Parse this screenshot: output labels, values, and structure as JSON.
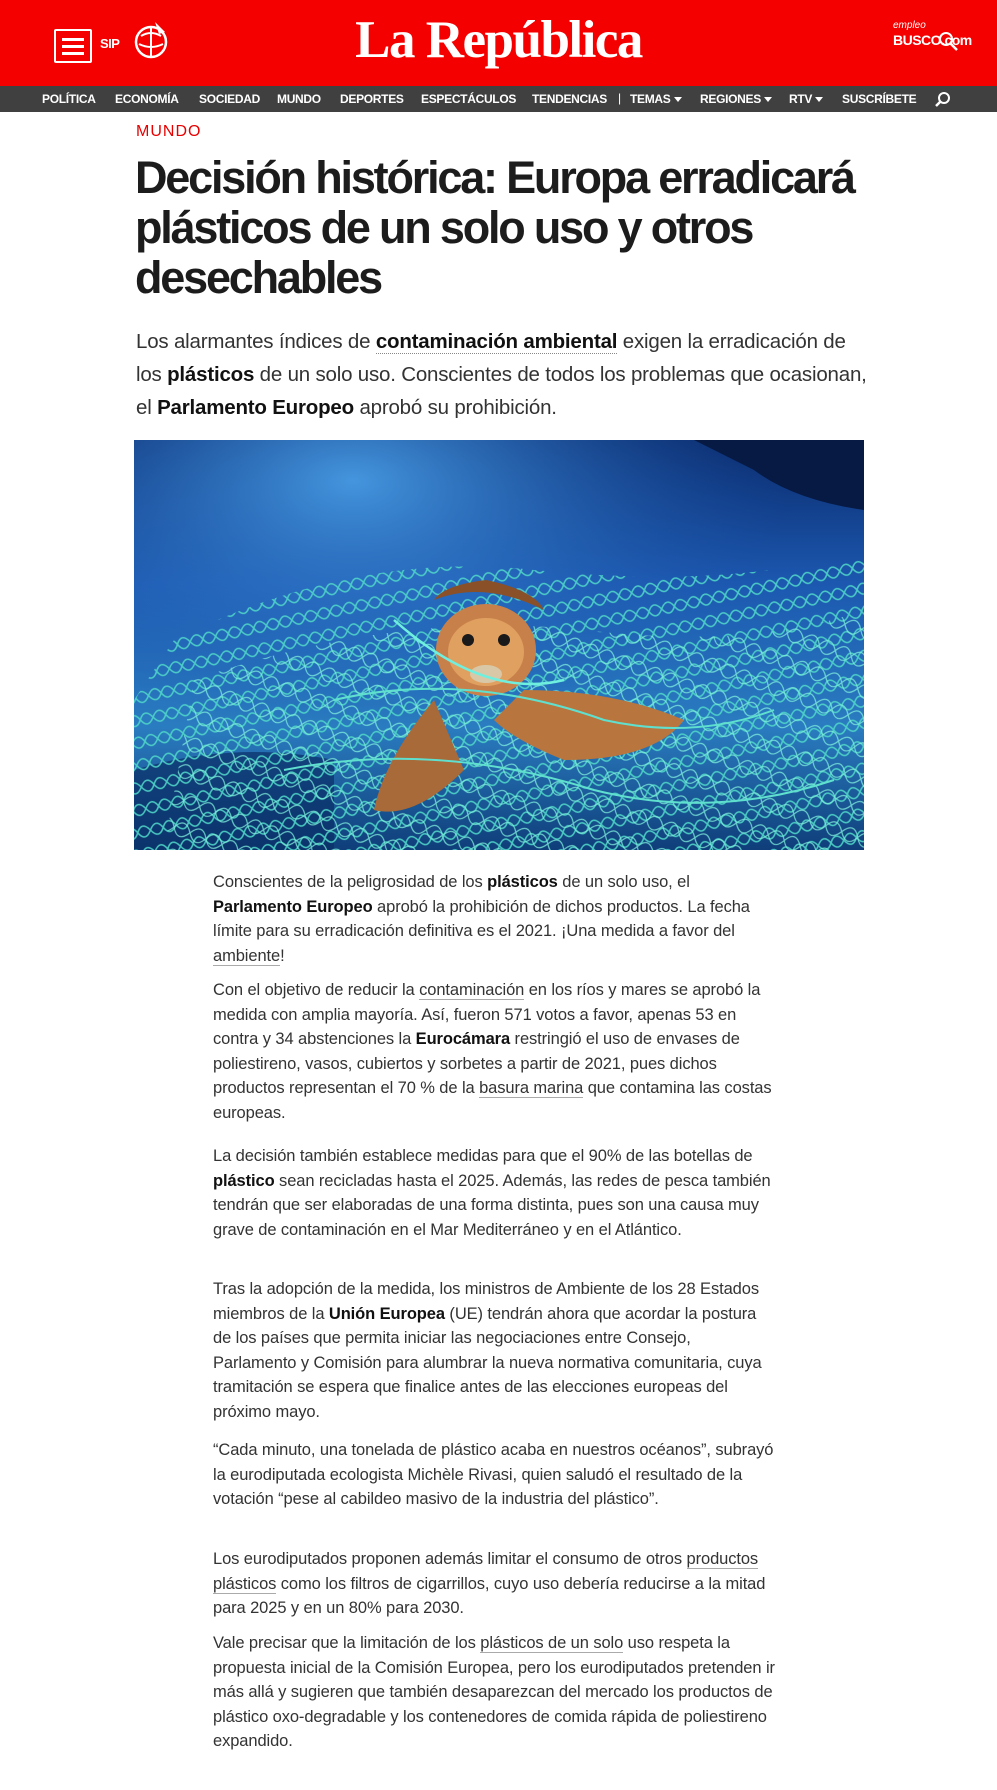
{
  "header": {
    "sip": "SIP",
    "brand": "La República",
    "empleo_small": "empleo",
    "empleo_big": "BUSCO.com",
    "colors": {
      "brand_red": "#f40000",
      "nav_bg": "#404040",
      "section_red": "#e60000"
    }
  },
  "nav": {
    "items": [
      "POLÍTICA",
      "ECONOMÍA",
      "SOCIEDAD",
      "MUNDO",
      "DEPORTES",
      "ESPECTÁCULOS",
      "TENDENCIAS"
    ],
    "separator": "|",
    "dropdowns": [
      "TEMAS",
      "REGIONES",
      "RTV"
    ],
    "subscribe": "SUSCRÍBETE"
  },
  "article": {
    "section": "MUNDO",
    "headline": "Decisión histórica: Europa erradicará plásticos de un solo uso y otros desechables",
    "lead": {
      "t1": "Los alarmantes índices de ",
      "b1": "contaminación ambiental",
      "t2": " exigen la erradicación de los ",
      "b2": "plásticos",
      "t3": " de un solo uso. Conscientes de todos los problemas que ocasionan, el ",
      "b3": "Parlamento Europeo",
      "t4": " aprobó su prohibición."
    },
    "p1": {
      "t1": "Conscientes de la peligrosidad de los ",
      "b1": "plásticos",
      "t2": " de un solo uso, el ",
      "b2": "Parlamento Europeo",
      "t3": " aprobó la prohibición de dichos productos. La fecha límite para su erradicación definitiva es el 2021. ¡Una medida a favor del ",
      "l1": "ambiente",
      "t4": "!"
    },
    "p2": {
      "t1": "Con el objetivo de reducir la ",
      "l1": "contaminación",
      "t2": " en los ríos y mares se aprobó la medida con amplia mayoría. Así, fueron 571 votos a favor, apenas 53 en contra y 34 abstenciones la ",
      "b1": "Eurocámara",
      "t3": " restringió el uso de envases de poliestireno, vasos, cubiertos y sorbetes a partir de 2021, pues dichos productos representan el  70 % de la ",
      "l2": "basura marina",
      "t4": " que contamina las costas europeas."
    },
    "p3": {
      "t1": "La decisión también establece medidas para que el 90% de las botellas de ",
      "b1": "plástico",
      "t2": " sean recicladas hasta el 2025. Además, las redes de pesca también tendrán que ser elaboradas de una forma distinta, pues son una causa muy grave de contaminación en el Mar Mediterráneo y en el Atlántico."
    },
    "p4": {
      "t1": "Tras la adopción de la medida, los ministros de Ambiente de los  28 Estados miembros de la ",
      "b1": "Unión Europea",
      "t2": " (UE) tendrán ahora que acordar la postura de los países que permita iniciar las negociaciones entre Consejo, Parlamento y Comisión para alumbrar la nueva normativa comunitaria, cuya tramitación se espera que finalice antes de las elecciones europeas del próximo mayo."
    },
    "p5": "“Cada minuto, una tonelada de plástico acaba en nuestros océanos”, subrayó la eurodiputada ecologista Michèle Rivasi, quien saludó el resultado de la votación “pese al cabildeo masivo de la industria del plástico”.",
    "p6": {
      "t1": "Los eurodiputados proponen además limitar el consumo de otros ",
      "l1": "productos plásticos",
      "t2": " como los filtros de cigarrillos, cuyo uso debería reducirse a la mitad para 2025 y en un 80% para 2030."
    },
    "p7": {
      "t1": "Vale precisar que la limitación de los ",
      "l1": "plásticos de un solo",
      "t2": " uso respeta la propuesta inicial de la Comisión Europea, pero los eurodiputados pretenden ir más allá y sugieren que también desaparezcan del mercado los productos de plástico oxo-degradable y los contenedores de comida rápida de poliestireno expandido."
    }
  }
}
